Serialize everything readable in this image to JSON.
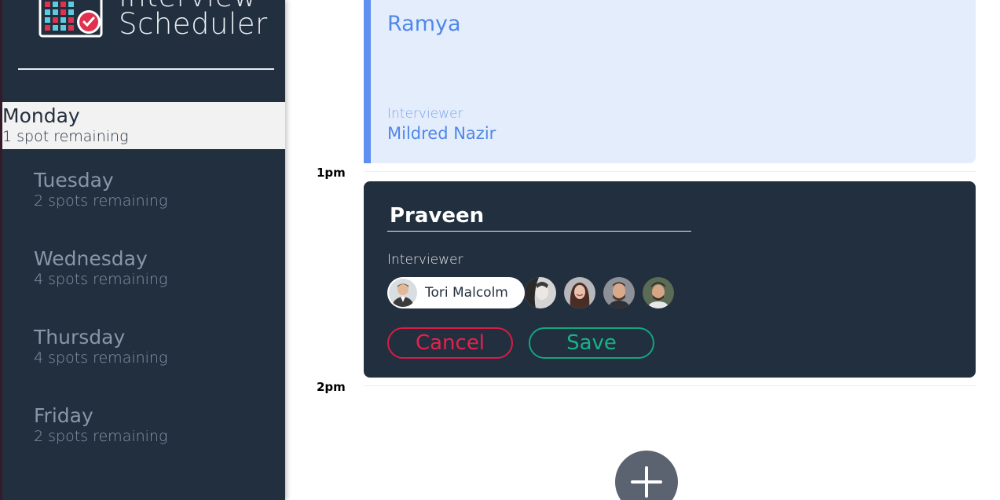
{
  "app": {
    "title_line1": "Interview",
    "title_line2": "Scheduler"
  },
  "sidebar": {
    "days": [
      {
        "name": "Monday",
        "spots": "1 spot remaining",
        "selected": true
      },
      {
        "name": "Tuesday",
        "spots": "2 spots remaining",
        "selected": false
      },
      {
        "name": "Wednesday",
        "spots": "4 spots remaining",
        "selected": false
      },
      {
        "name": "Thursday",
        "spots": "4 spots remaining",
        "selected": false
      },
      {
        "name": "Friday",
        "spots": "2 spots remaining",
        "selected": false
      }
    ]
  },
  "schedule": {
    "times": [
      "1pm",
      "2pm"
    ],
    "booked": {
      "student": "Ramya",
      "interviewer_label": "Interviewer",
      "interviewer_name": "Mildred Nazir"
    },
    "form": {
      "student_value": "Praveen",
      "interviewer_label": "Interviewer",
      "selected_interviewer": "Tori Malcolm",
      "cancel_label": "Cancel",
      "save_label": "Save"
    },
    "add_icon": "plus-icon"
  },
  "colors": {
    "sidebar_bg": "#222f3e",
    "booked_accent": "#5c8fef",
    "cancel": "#d71d47",
    "save": "#12a67e"
  }
}
